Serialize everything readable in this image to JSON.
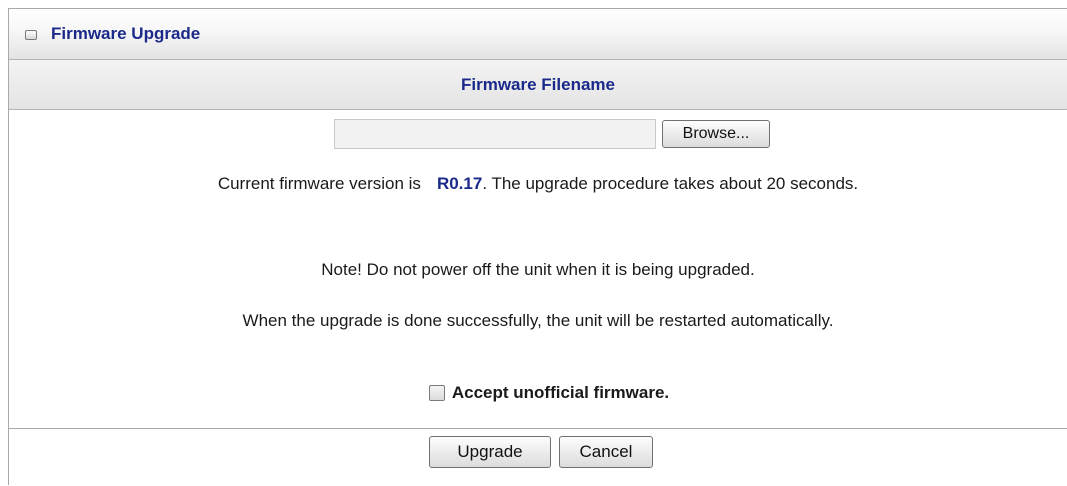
{
  "panel": {
    "title": "Firmware Upgrade",
    "title_icon": "window-icon"
  },
  "section": {
    "header": "Firmware Filename"
  },
  "file_input": {
    "value": "",
    "browse_label": "Browse..."
  },
  "info": {
    "version_prefix": "Current firmware version is",
    "version_value": "R0.17",
    "version_suffix": ". The upgrade procedure takes about 20 seconds.",
    "note": "Note! Do not power off the unit when it is being upgraded.",
    "restart": "When the upgrade is done successfully, the unit will be restarted automatically."
  },
  "accept": {
    "label": "Accept unofficial firmware.",
    "checked": false
  },
  "actions": {
    "upgrade_label": "Upgrade",
    "cancel_label": "Cancel"
  },
  "colors": {
    "accent": "#1b2a8a",
    "border": "#a9a9a9",
    "header_bg": "#e4e4e4"
  }
}
